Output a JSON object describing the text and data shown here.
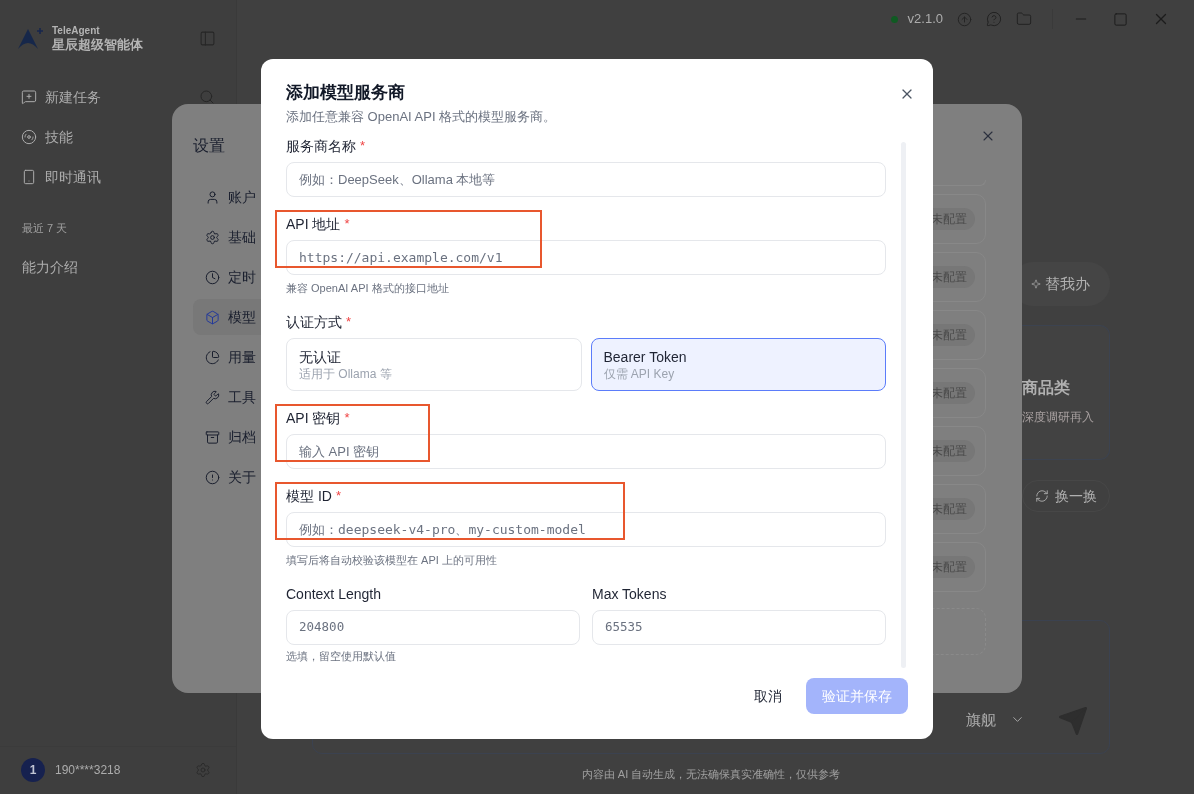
{
  "app": {
    "logo": {
      "brand": "TeleAgent",
      "name": "星辰超级智能体"
    },
    "nav": [
      {
        "label": "新建任务"
      },
      {
        "label": "技能"
      },
      {
        "label": "即时通讯"
      }
    ],
    "section_title": "最近 7 天",
    "history": [
      {
        "label": "能力介绍"
      }
    ],
    "user": {
      "avatar": "1",
      "name": "190****3218"
    },
    "status": {
      "online": true,
      "version": "v2.1.0"
    },
    "quick_action": "替我办",
    "card": {
      "title": "商品类",
      "text": "深度调研再入"
    },
    "refresh": "换一换",
    "model_select": "旗舰",
    "disclaimer": "内容由 AI 自动生成，无法确保真实准确性，仅供参考"
  },
  "settings": {
    "title": "设置",
    "nav": [
      {
        "label": "账户",
        "selected": false
      },
      {
        "label": "基础",
        "selected": false
      },
      {
        "label": "定时",
        "selected": false
      },
      {
        "label": "模型",
        "selected": true
      },
      {
        "label": "用量",
        "selected": false
      },
      {
        "label": "工具",
        "selected": false
      },
      {
        "label": "归档",
        "selected": false
      },
      {
        "label": "关于",
        "selected": false
      }
    ],
    "rows": [
      {
        "status": "未配置"
      },
      {
        "status": "未配置"
      },
      {
        "status": "未配置"
      },
      {
        "status": "未配置"
      },
      {
        "status": "未配置"
      },
      {
        "status": "未配置"
      },
      {
        "status": "未配置"
      }
    ]
  },
  "dialog": {
    "title": "添加模型服务商",
    "subtitle": "添加任意兼容 OpenAI API 格式的模型服务商。",
    "fields": [
      {
        "kind": "input",
        "label": "服务商名称",
        "required_mark": "*",
        "placeholder": "例如：DeepSeek、Ollama 本地等",
        "highlighted": false
      },
      {
        "kind": "code_input",
        "label": "API 地址",
        "required_mark": "*",
        "placeholder": "https://api.example.com/v1",
        "hint": "兼容 OpenAI API 格式的接口地址",
        "highlighted": true
      },
      {
        "kind": "choice",
        "label": "认证方式",
        "required_mark": "*",
        "options": [
          {
            "title": "无认证",
            "subtitle": "适用于 Ollama 等",
            "selected": false
          },
          {
            "title": "Bearer Token",
            "subtitle": "仅需 API Key",
            "selected": true
          }
        ]
      },
      {
        "kind": "input",
        "label": "API 密钥",
        "required_mark": "*",
        "placeholder": "输入 API 密钥",
        "highlighted": true
      },
      {
        "kind": "code_input",
        "label": "模型 ID",
        "required_mark": "*",
        "placeholder": "例如：deepseek-v4-pro、my-custom-model",
        "hint": "填写后将自动校验该模型在 API 上的可用性",
        "highlighted": true
      },
      {
        "kind": "pair",
        "items": [
          {
            "label": "Context Length",
            "placeholder": "204800"
          },
          {
            "label": "Max Tokens",
            "placeholder": "65535"
          }
        ],
        "hint": "选填，留空使用默认值"
      }
    ],
    "buttons": [
      {
        "label": "取消",
        "kind": "text",
        "disabled": false
      },
      {
        "label": "验证并保存",
        "kind": "primary",
        "disabled": true
      }
    ]
  }
}
